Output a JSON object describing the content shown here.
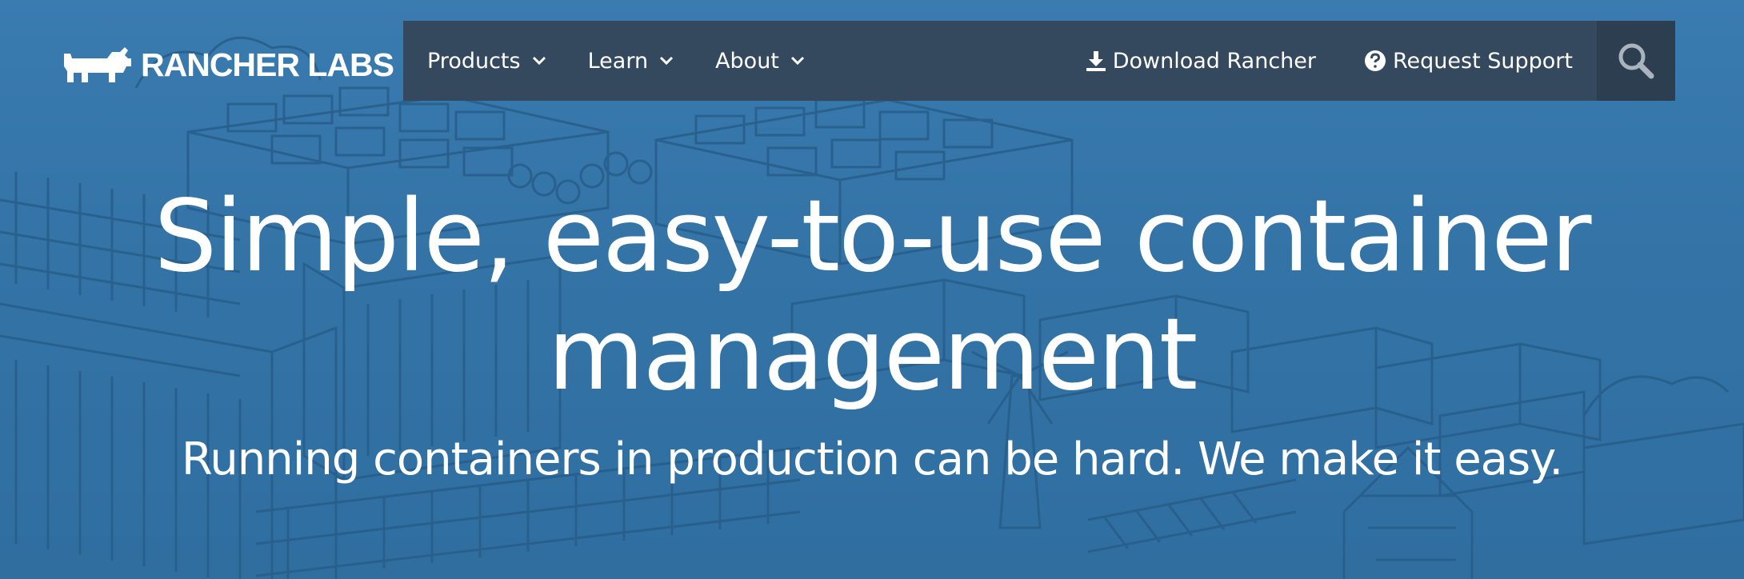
{
  "brand": {
    "name": "RANCHER LABS",
    "logo_icon": "rancher-bull-icon"
  },
  "nav": {
    "left_items": [
      {
        "label": "Products",
        "icon": "chevron-down-icon"
      },
      {
        "label": "Learn",
        "icon": "chevron-down-icon"
      },
      {
        "label": "About",
        "icon": "chevron-down-icon"
      }
    ],
    "right_items": [
      {
        "label": "Download Rancher",
        "icon": "download-icon"
      },
      {
        "label": "Request Support",
        "icon": "question-circle-icon"
      }
    ],
    "search_icon": "search-icon"
  },
  "hero": {
    "headline_line1": "Simple, easy-to-use container",
    "headline_line2": "management",
    "subheadline": "Running containers in production can be hard. We make it easy."
  },
  "colors": {
    "hero_bg": "#3373a6",
    "navbar_bg": "#34495e",
    "search_bg": "#2c3e50",
    "text": "#ffffff"
  }
}
